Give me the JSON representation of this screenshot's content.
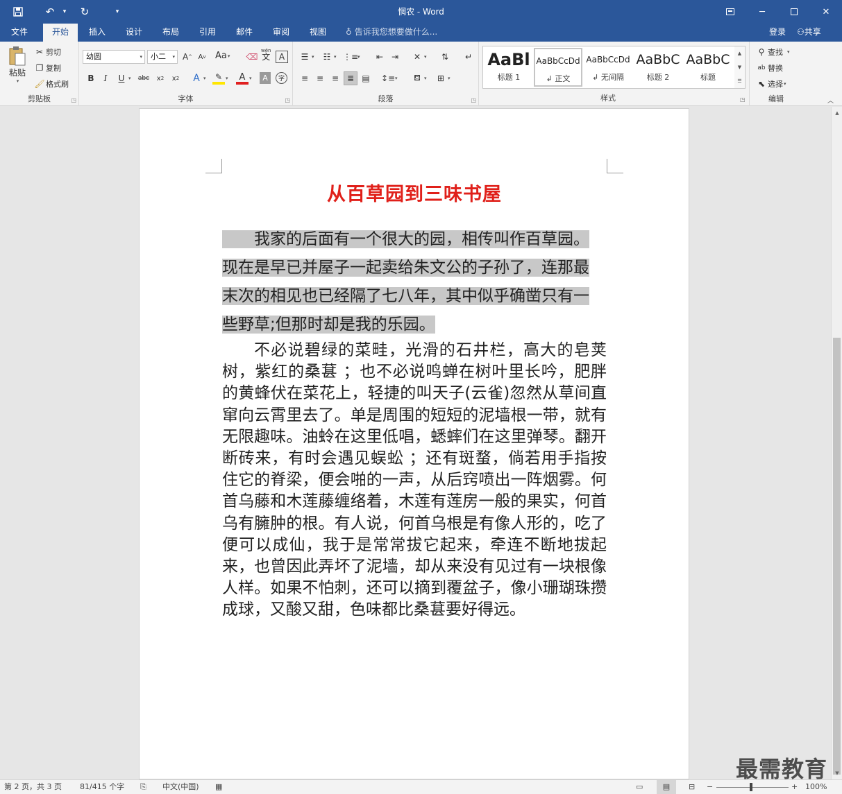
{
  "window": {
    "title": "惘农 - Word",
    "qat": {
      "undo_dd": "▾",
      "customize": "▾"
    }
  },
  "tabs": [
    {
      "label": "文件"
    },
    {
      "label": "开始"
    },
    {
      "label": "插入"
    },
    {
      "label": "设计"
    },
    {
      "label": "布局"
    },
    {
      "label": "引用"
    },
    {
      "label": "邮件"
    },
    {
      "label": "审阅"
    },
    {
      "label": "视图"
    }
  ],
  "tellme": "告诉我您想要做什么...",
  "account": {
    "login": "登录",
    "share": "共享"
  },
  "clipboard": {
    "label": "剪贴板",
    "paste": "粘贴",
    "cut": "剪切",
    "copy": "复制",
    "format_painter": "格式刷"
  },
  "font": {
    "label": "字体",
    "name": "幼圆",
    "size": "小二",
    "change_case": "Aa",
    "wen": "wén",
    "wen_char": "文"
  },
  "paragraph": {
    "label": "段落"
  },
  "styles": {
    "label": "样式",
    "items": [
      {
        "preview": "AaBl",
        "name": "标题 1"
      },
      {
        "preview": "AaBbCcDd",
        "name": "↲ 正文"
      },
      {
        "preview": "AaBbCcDd",
        "name": "↲ 无间隔"
      },
      {
        "preview": "AaBbC",
        "name": "标题 2"
      },
      {
        "preview": "AaBbC",
        "name": "标题"
      }
    ]
  },
  "editing": {
    "label": "编辑",
    "find": "查找",
    "replace": "替换",
    "select": "选择"
  },
  "document": {
    "title": "从百草园到三味书屋",
    "para1_lines": [
      "　　我家的后面有一个很大的园，相传叫作百草园。",
      "现在是早已并屋子一起卖给朱文公的子孙了，连那最",
      "末次的相见也已经隔了七八年，其中似乎确凿只有一",
      "些野草;但那时却是我的乐园。"
    ],
    "para2": "不必说碧绿的菜畦，光滑的石井栏，高大的皂荚树，紫红的桑葚 ；也不必说鸣蝉在树叶里长吟，肥胖的黄蜂伏在菜花上，轻捷的叫天子(云雀)忽然从草间直窜向云霄里去了。单是周围的短短的泥墙根一带，就有无限趣味。油蛉在这里低唱，蟋蟀们在这里弹琴。翻开断砖来，有时会遇见蜈蚣 ；还有斑蝥，倘若用手指按住它的脊梁，便会啪的一声，从后窍喷出一阵烟雾。何首乌藤和木莲藤缠络着，木莲有莲房一般的果实，何首乌有臃肿的根。有人说，何首乌根是有像人形的，吃了便可以成仙，我于是常常拔它起来，牵连不断地拔起来，也曾因此弄坏了泥墙，却从来没有见过有一块根像人样。如果不怕刺，还可以摘到覆盆子，像小珊瑚珠攒成球，又酸又甜，色味都比桑葚要好得远。"
  },
  "status": {
    "page": "第 2 页，共 3 页",
    "words": "81/415 个字",
    "language": "中文(中国)",
    "zoom": "100%"
  },
  "watermark": "最需教育",
  "colors": {
    "accent": "#2b579a",
    "title_red": "#e0201a",
    "highlight": "#c8c8c8"
  }
}
